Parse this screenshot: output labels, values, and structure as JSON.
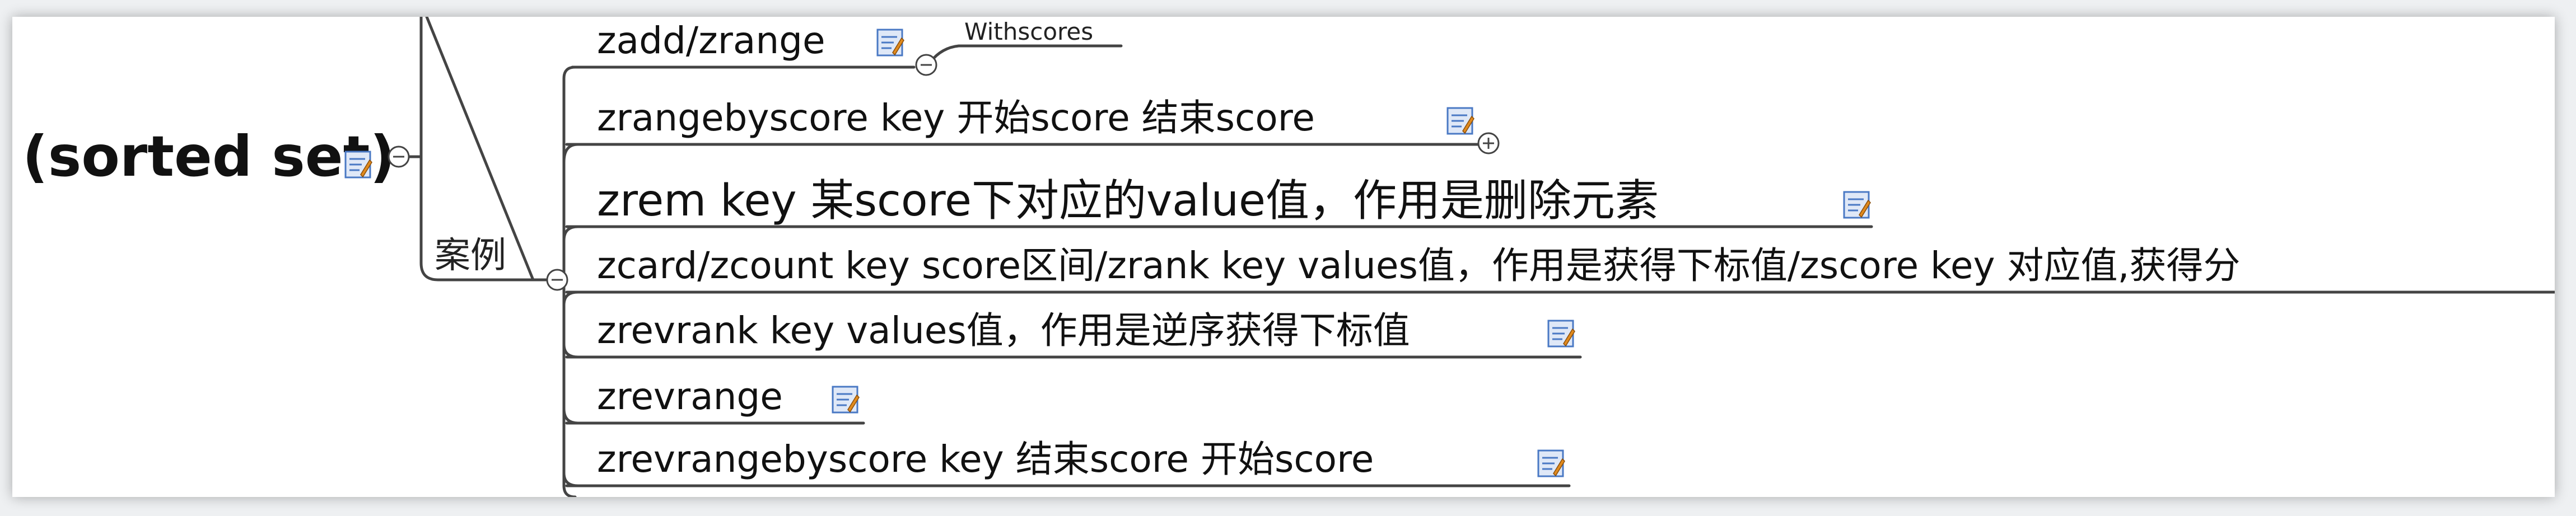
{
  "root": {
    "label": "(sorted set)"
  },
  "category": {
    "label": "案例"
  },
  "items": [
    {
      "label": "zadd/zrange"
    },
    {
      "label": "zrangebyscore key 开始score 结束score"
    },
    {
      "label": "zrem key 某score下对应的value值，作用是删除元素"
    },
    {
      "label": "zcard/zcount key score区间/zrank key values值，作用是获得下标值/zscore key 对应值,获得分"
    },
    {
      "label": "zrevrank key values值，作用是逆序获得下标值"
    },
    {
      "label": "zrevrange"
    },
    {
      "label": "zrevrangebyscore  key 结束score 开始score"
    }
  ],
  "attribute": {
    "label": "Withscores"
  },
  "icons": {
    "note": "note-edit-icon",
    "collapse": "collapse-minus-icon",
    "expand": "expand-plus-icon"
  },
  "colors": {
    "line": "#444444",
    "note_blue": "#4a79c4",
    "note_orange": "#e08a1e"
  }
}
